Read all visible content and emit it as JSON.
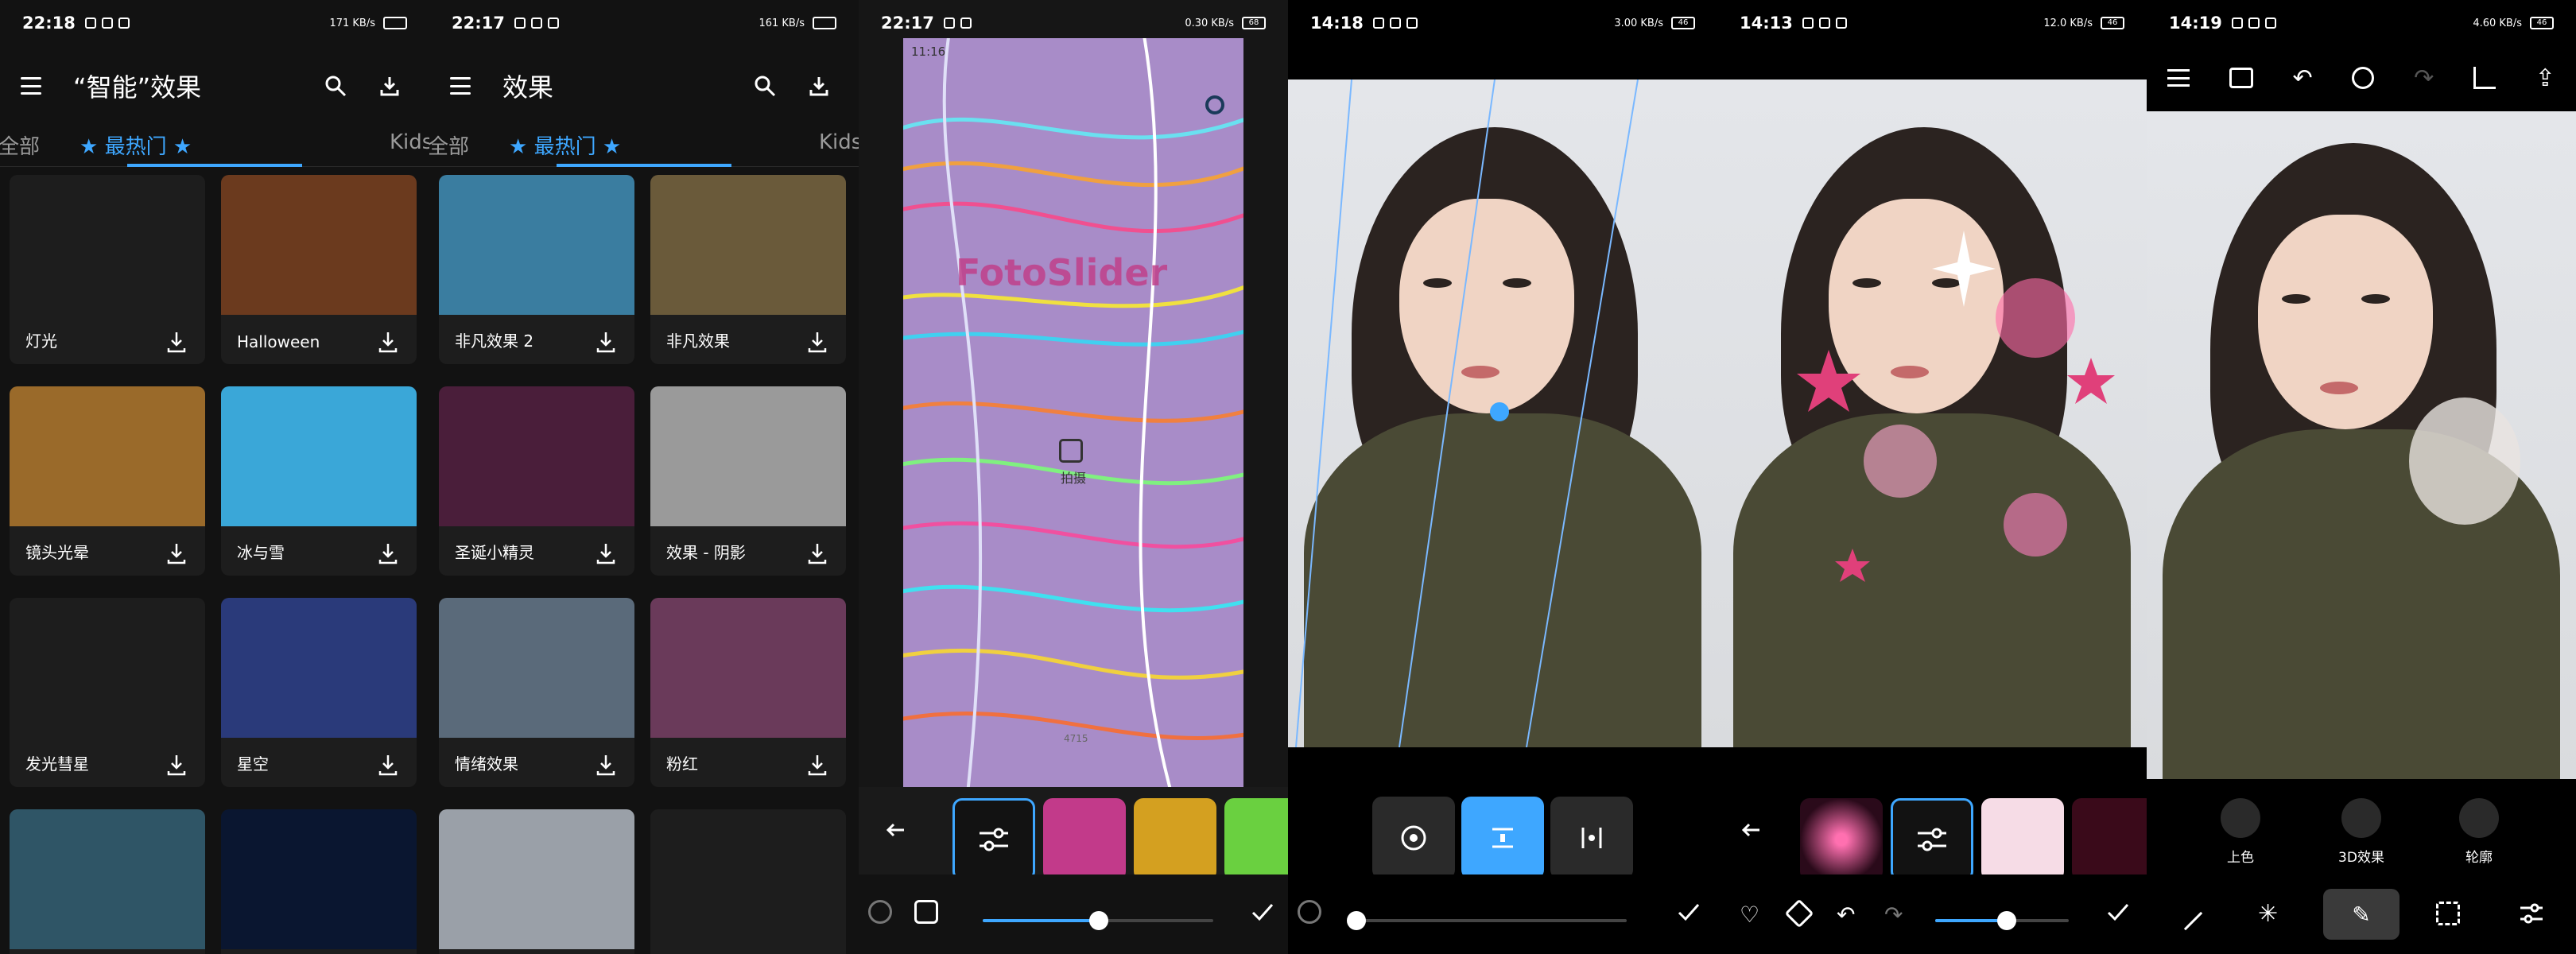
{
  "panel1": {
    "status": {
      "time": "22:18",
      "net": "171 KB/s"
    },
    "title": "“智能”效果",
    "tabs": {
      "all": "全部",
      "hot": "★ 最热门 ★",
      "kids": "Kids"
    },
    "cards": [
      {
        "label": "灯光",
        "color": "#1d1d1d"
      },
      {
        "label": "Halloween",
        "color": "#6b3a1e"
      },
      {
        "label": "镜头光晕",
        "color": "#9a6a2a"
      },
      {
        "label": "冰与雪",
        "color": "#3aa7d8"
      },
      {
        "label": "发光彗星",
        "color": "#1d1d1d"
      },
      {
        "label": "星空",
        "color": "#2a3a7a"
      },
      {
        "label": "",
        "color": "#2f5566"
      },
      {
        "label": "",
        "color": "#0a1630"
      }
    ]
  },
  "panel2": {
    "status": {
      "time": "22:17",
      "net": "161 KB/s"
    },
    "title": "效果",
    "tabs": {
      "all": "全部",
      "hot": "★ 最热门 ★",
      "kids": "Kids"
    },
    "cards": [
      {
        "label": "非凡效果 2",
        "color": "#3a7da0"
      },
      {
        "label": "非凡效果",
        "color": "#6a5a3a"
      },
      {
        "label": "圣诞小精灵",
        "color": "#4a1e3a"
      },
      {
        "label": "效果 - 阴影",
        "color": "#9a9a9a"
      },
      {
        "label": "情绪效果",
        "color": "#5a6a7a"
      },
      {
        "label": "粉红",
        "color": "#6a3a5a"
      },
      {
        "label": "",
        "color": "#9aa0a8"
      },
      {
        "label": "",
        "color": "#1d1d1d"
      }
    ]
  },
  "panel3": {
    "status": {
      "time": "22:17",
      "net": "0.30 KB/s",
      "battery": "68"
    },
    "inner_status": {
      "time": "11:16"
    },
    "overlay_logo": "FotoSlider",
    "overlay_small": "拍摄",
    "footer_small": "4715",
    "thumb_colors": [
      "#1a3a5a",
      "#c23a8a",
      "#d4a020",
      "#6ad040"
    ]
  },
  "panel4": {
    "status": {
      "time": "14:18",
      "net": "3.00 KB/s",
      "battery": "46"
    }
  },
  "panel5": {
    "status": {
      "time": "14:13",
      "net": "12.0 KB/s",
      "battery": "46"
    }
  },
  "panel6": {
    "status": {
      "time": "14:19",
      "net": "4.60 KB/s",
      "battery": "46"
    },
    "tools": [
      {
        "label": "上色"
      },
      {
        "label": "3D效果"
      },
      {
        "label": "轮廓"
      }
    ]
  },
  "colors": {
    "accent": "#3ea7ff",
    "bg": "#121212",
    "card": "#1d1d1d"
  }
}
